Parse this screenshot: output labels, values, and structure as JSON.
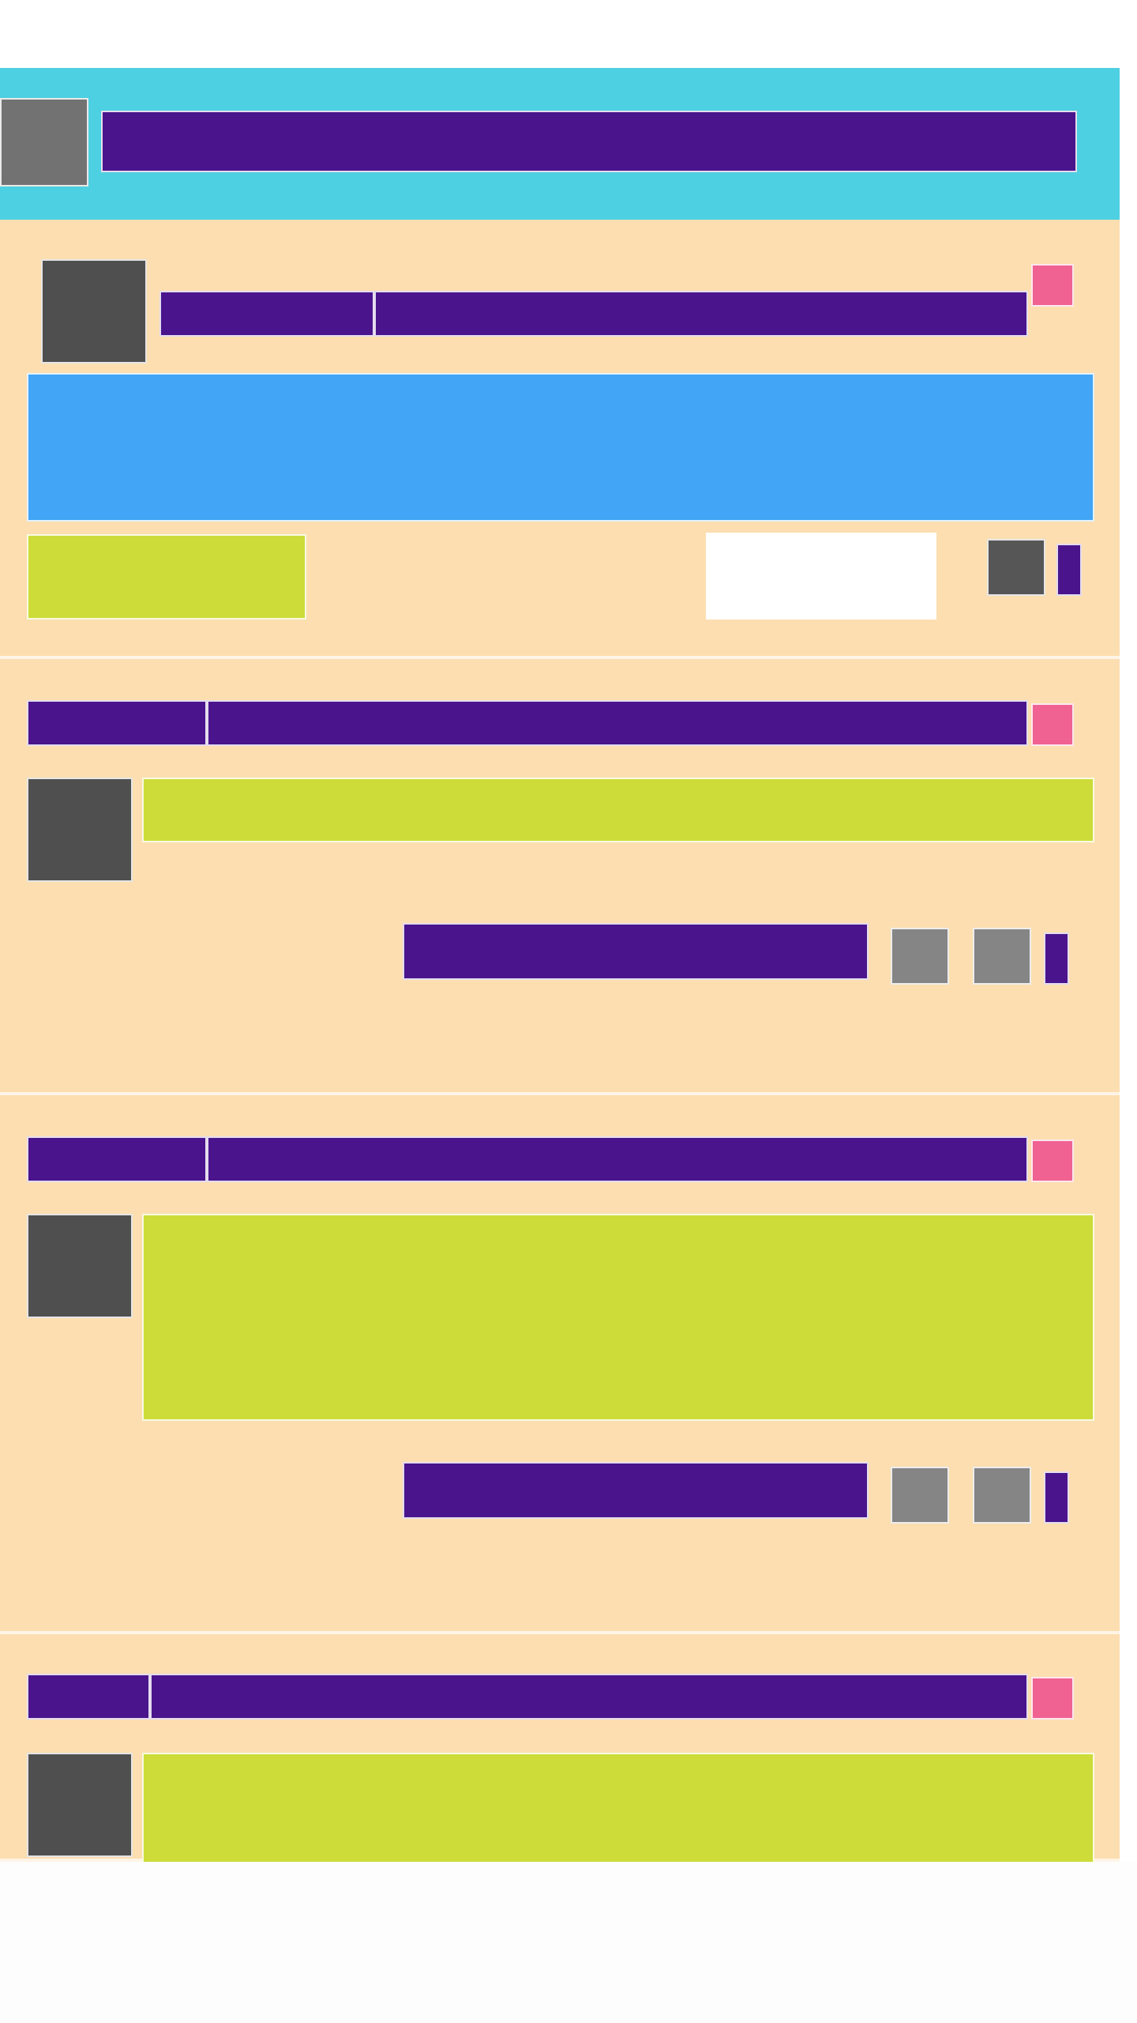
{
  "app": {
    "title": "",
    "header_title": ""
  },
  "feed": {
    "cards": [
      {
        "author": "",
        "headline": "",
        "body": "",
        "footer_chip": ""
      },
      {
        "author": "",
        "headline": "",
        "body": "",
        "action_label": ""
      },
      {
        "author": "",
        "headline": "",
        "body": "",
        "action_label": ""
      },
      {
        "author": "",
        "headline": "",
        "body": ""
      }
    ]
  },
  "colors": {
    "topbar": "#4dd0e1",
    "card": "#fcdeb0",
    "primary_text_block": "#4a148c",
    "accent_badge": "#f06292",
    "media_block": "#42a5f5",
    "content_block": "#cddc39",
    "avatar_gray": "#4f4f4f",
    "icon_gray": "#858585",
    "page_bg": "#ffffff"
  },
  "icons": {
    "header_avatar": "avatar-icon",
    "card_avatar": "avatar-icon",
    "card_badge": "badge-icon",
    "share": "share-icon",
    "like": "like-icon",
    "more": "more-icon"
  }
}
